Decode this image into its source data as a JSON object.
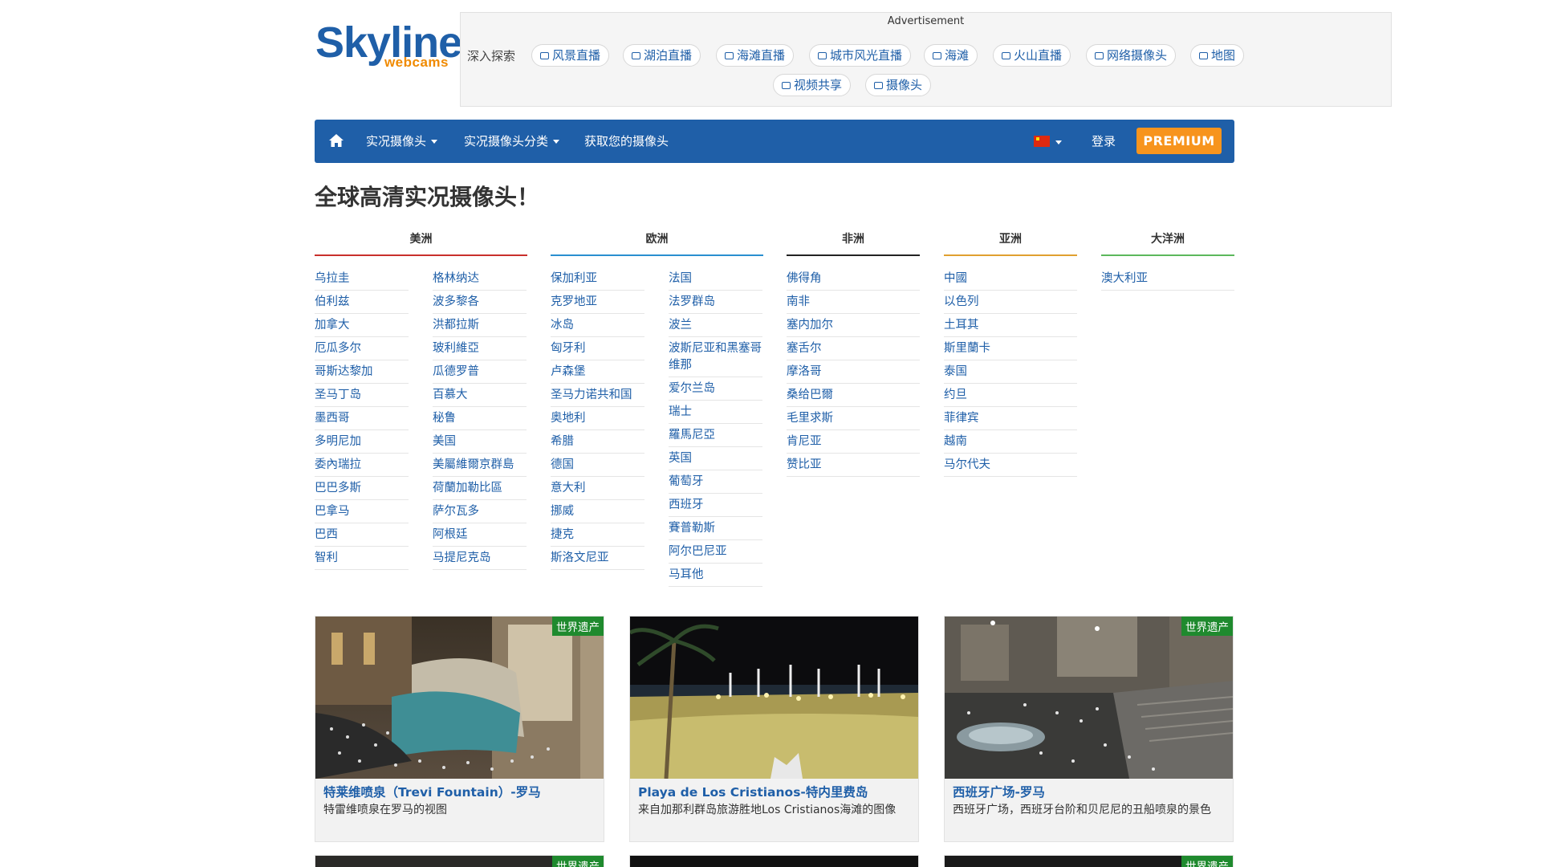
{
  "logo": {
    "main": "Skyline",
    "sub": "webcams"
  },
  "ad": {
    "label": "Advertisement",
    "deep_label": "深入探索",
    "pills": [
      "风景直播",
      "湖泊直播",
      "海滩直播",
      "城市风光直播",
      "海滩",
      "火山直播",
      "网络摄像头",
      "地图",
      "视频共享",
      "摄像头"
    ]
  },
  "nav": {
    "live_cams": "实况摄像头",
    "categories": "实况摄像头分类",
    "get_cam": "获取您的摄像头",
    "login": "登录",
    "premium": "PREMIUM"
  },
  "headline": "全球高清实况摄像头！",
  "continents": [
    {
      "name": "美洲",
      "color": "#c9302c"
    },
    {
      "name": "欧洲",
      "color": "#2a8fd0"
    },
    {
      "name": "非洲",
      "color": "#222222"
    },
    {
      "name": "亚洲",
      "color": "#e0a030"
    },
    {
      "name": "大洋洲",
      "color": "#5cb85c"
    }
  ],
  "countries": {
    "america_1": [
      "乌拉圭",
      "伯利兹",
      "加拿大",
      "厄瓜多尔",
      "哥斯达黎加",
      "圣马丁岛",
      "墨西哥",
      "多明尼加",
      "委內瑞拉",
      "巴巴多斯",
      "巴拿马",
      "巴西",
      "智利"
    ],
    "america_2": [
      "格林纳达",
      "波多黎各",
      "洪都拉斯",
      "玻利維亞",
      "瓜德罗普",
      "百慕大",
      "秘鲁",
      "美国",
      "美屬維爾京群島",
      "荷蘭加勒比區",
      "萨尔瓦多",
      "阿根廷",
      "马提尼克岛"
    ],
    "europe_1": [
      "保加利亚",
      "克罗地亚",
      "冰岛",
      "匈牙利",
      "卢森堡",
      "圣马力诺共和国",
      "奥地利",
      "希腊",
      "德国",
      "意大利",
      "挪威",
      "捷克",
      "斯洛文尼亚"
    ],
    "europe_2": [
      "法国",
      "法罗群岛",
      "波兰",
      "波斯尼亚和黑塞哥维那",
      "爱尔兰岛",
      "瑞士",
      "羅馬尼亞",
      "英国",
      "葡萄牙",
      "西班牙",
      "賽普勒斯",
      "阿尔巴尼亚",
      "马耳他"
    ],
    "africa": [
      "佛得角",
      "南非",
      "塞内加尔",
      "塞舌尔",
      "摩洛哥",
      "桑给巴爾",
      "毛里求斯",
      "肯尼亚",
      "赞比亚"
    ],
    "asia": [
      "中國",
      "以色列",
      "土耳其",
      "斯里蘭卡",
      "泰国",
      "约旦",
      "菲律宾",
      "越南",
      "马尔代夫"
    ],
    "oceania": [
      "澳大利亚"
    ]
  },
  "cards": [
    {
      "badge": "世界遗产",
      "title": "特莱维喷泉（Trevi Fountain）-罗马",
      "desc": "特雷维喷泉在罗马的视图"
    },
    {
      "badge": "",
      "title": "Playa de Los Cristianos-特内里费岛",
      "desc": "来自加那利群岛旅游胜地Los Cristianos海滩的图像"
    },
    {
      "badge": "世界遗产",
      "title": "西班牙广场-罗马",
      "desc": "西班牙广场，西班牙台阶和贝尼尼的丑船喷泉的景色"
    }
  ],
  "row2_badges": [
    "世界遗产",
    "",
    "世界遗产"
  ]
}
